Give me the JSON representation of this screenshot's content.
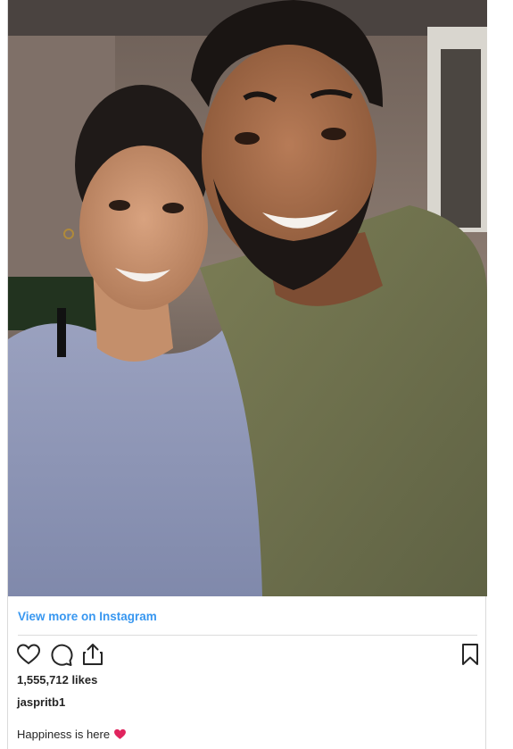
{
  "post": {
    "image_alt": "Selfie of a smiling man in an olive t-shirt and a smiling woman in a grey-blue top",
    "view_more_label": "View more on Instagram",
    "likes": "1,555,712 likes",
    "username": "jaspritb1",
    "caption": "Happiness is here"
  },
  "icons": {
    "like": "heart-icon",
    "comment": "comment-icon",
    "share": "share-icon",
    "save": "bookmark-icon",
    "caption_emoji": "red-heart-emoji"
  },
  "colors": {
    "link": "#3897f0",
    "text": "#262626",
    "divider": "#dbdbdb",
    "emoji_heart": "#e0245e"
  }
}
